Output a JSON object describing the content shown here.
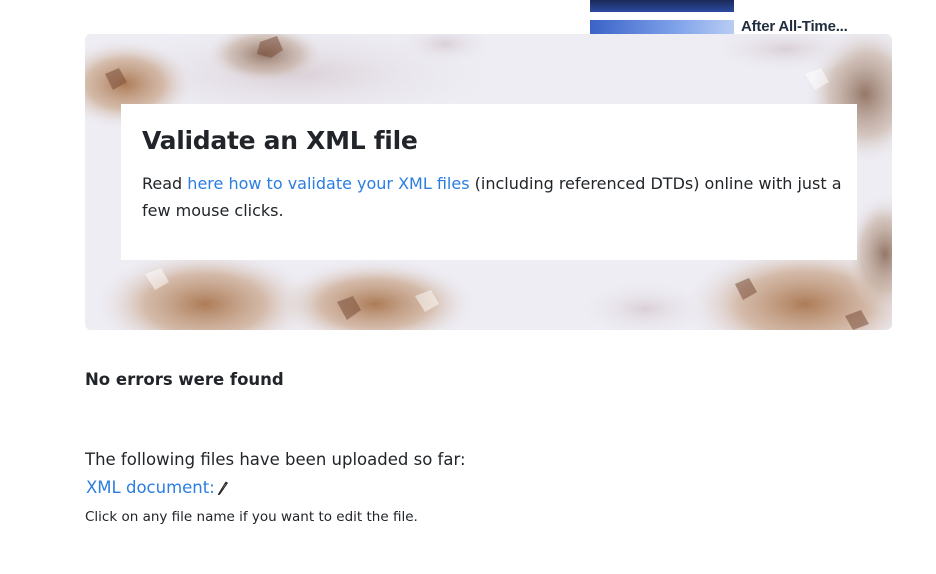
{
  "news": {
    "title": "After All-Time..."
  },
  "hero": {
    "title": "Validate an XML file",
    "text_before": "Read ",
    "link_text": "here how to validate your XML files",
    "text_after": " (including referenced DTDs) online with just a few mouse clicks."
  },
  "result": {
    "message": "No errors were found"
  },
  "uploads": {
    "intro": "The following files have been uploaded so far:",
    "files": [
      {
        "label": "XML document:"
      }
    ],
    "hint": "Click on any file name if you want to edit the file."
  },
  "colors": {
    "link": "#2a7de1",
    "text": "#212529",
    "news_thumb": "#3a63c7"
  },
  "icons": {
    "edit": "pencil-icon"
  }
}
